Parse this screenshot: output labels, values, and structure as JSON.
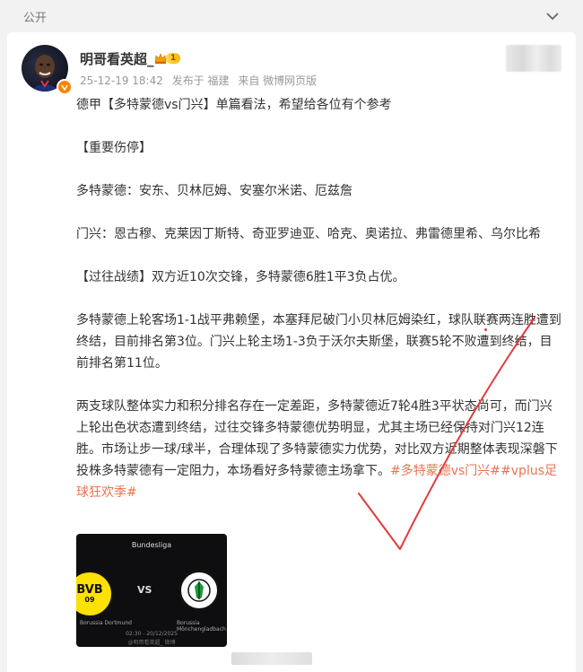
{
  "header": {
    "visibility": "公开"
  },
  "author": {
    "name": "明哥看英超_",
    "level": "1",
    "accent": "#ff8200"
  },
  "meta": {
    "time": "25-12-19 18:42",
    "publish": "发布于 福建",
    "source": "来自 微博网页版"
  },
  "post": {
    "p1": "德甲【多特蒙德vs门兴】单篇看法，希望给各位有个参考",
    "p2": "【重要伤停】",
    "p3": "多特蒙德：安东、贝林厄姆、安塞尔米诺、厄兹詹",
    "p4": "门兴：恩古穆、克莱因丁斯特、奇亚罗迪亚、哈克、奥诺拉、弗雷德里希、乌尔比希",
    "p5": "【过往战绩】双方近10次交锋，多特蒙德6胜1平3负占优。",
    "p6": "多特蒙德上轮客场1-1战平弗赖堡，本塞拜尼破门小贝林厄姆染红，球队联赛两连胜遭到终结，目前排名第3位。门兴上轮主场1-3负于沃尔夫斯堡，联赛5轮不败遭到终结，目前排名第11位。",
    "p7": "两支球队整体实力和积分排名存在一定差距，多特蒙德近7轮4胜3平状态尚可，而门兴上轮出色状态遭到终结，过往交锋多特蒙德优势明显，尤其主场已经保持对门兴12连胜。市场让步一球/球半，合理体现了多特蒙德实力优势，对比双方近期整体表现深磐下投株多特蒙德有一定阻力，本场看好多特蒙德主场拿下。",
    "hashtags": "#多特蒙德vs门兴##vplus足球狂欢季#",
    "tag_color": "#eb7350"
  },
  "image": {
    "league": "Bundesliga",
    "vs": "VS",
    "club_a_badge": "BVB",
    "club_a_badge_sub": "09",
    "club_a": "Borussia Dortmund",
    "club_b": "Borussia Mönchengladbach",
    "datetime": "02:30 - 20/12/2025",
    "watermark": "@明哥看英超_ 微博"
  },
  "icons": {
    "chevron": "chevron-down-icon",
    "verified": "verified-badge-icon",
    "crown": "crown-icon",
    "check": "check-mark-annotation"
  }
}
